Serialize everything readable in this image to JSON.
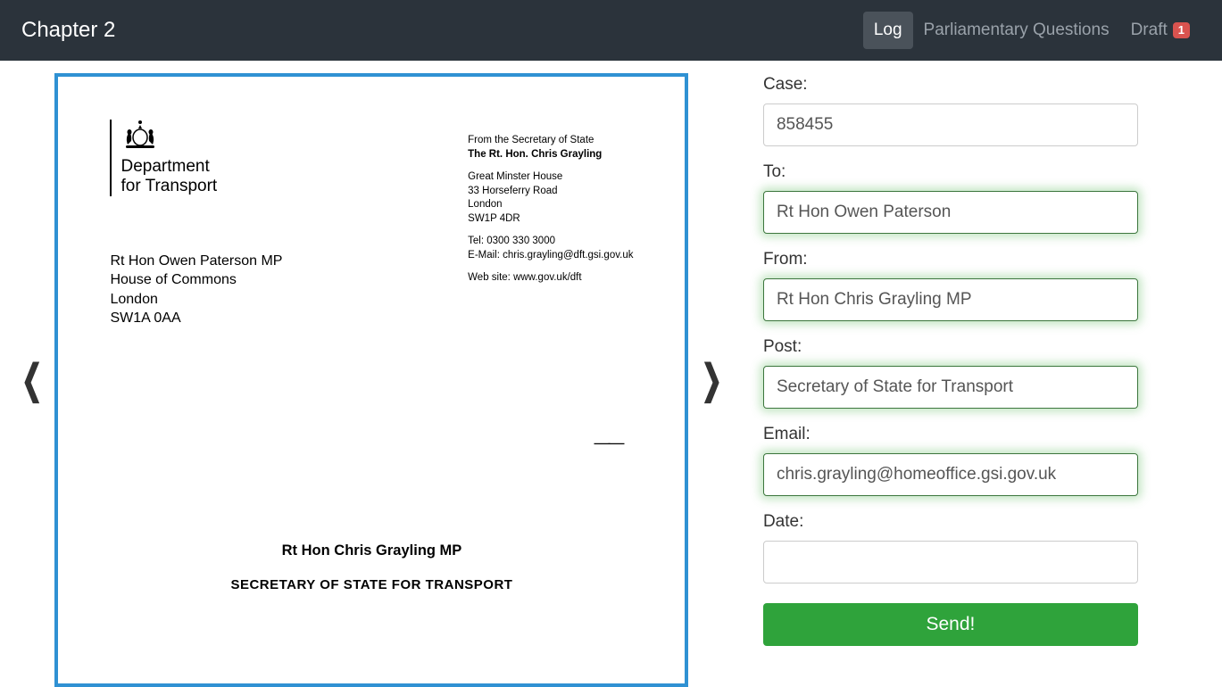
{
  "navbar": {
    "brand": "Chapter 2",
    "items": [
      {
        "label": "Log",
        "active": true
      },
      {
        "label": "Parliamentary Questions",
        "active": false
      },
      {
        "label": "Draft",
        "active": false,
        "badge": "1"
      }
    ]
  },
  "document": {
    "department_line1": "Department",
    "department_line2": "for Transport",
    "from_intro": "From the Secretary of State",
    "from_name": "The Rt. Hon. Chris Grayling",
    "address_line1": "Great Minster House",
    "address_line2": "33 Horseferry Road",
    "address_line3": "London",
    "address_line4": "SW1P 4DR",
    "tel_label": "Tel: 0300 330 3000",
    "email_label": "E-Mail: chris.grayling@dft.gsi.gov.uk",
    "website_label": "Web site: www.gov.uk/dft",
    "recipient_line1": "Rt Hon Owen Paterson MP",
    "recipient_line2": "House of Commons",
    "recipient_line3": "London",
    "recipient_line4": "SW1A 0AA",
    "signer_name": "Rt Hon Chris Grayling MP",
    "signer_post": "SECRETARY OF STATE FOR TRANSPORT"
  },
  "form": {
    "case_label": "Case:",
    "case_value": "858455",
    "to_label": "To:",
    "to_value": "Rt Hon Owen Paterson",
    "from_label": "From:",
    "from_value": "Rt Hon Chris Grayling MP",
    "post_label": "Post:",
    "post_value": "Secretary of State for Transport",
    "email_label": "Email:",
    "email_value": "chris.grayling@homeoffice.gsi.gov.uk",
    "date_label": "Date:",
    "date_value": "",
    "send_label": "Send!"
  },
  "nav_chevrons": {
    "prev": "❮",
    "next": "❯"
  }
}
